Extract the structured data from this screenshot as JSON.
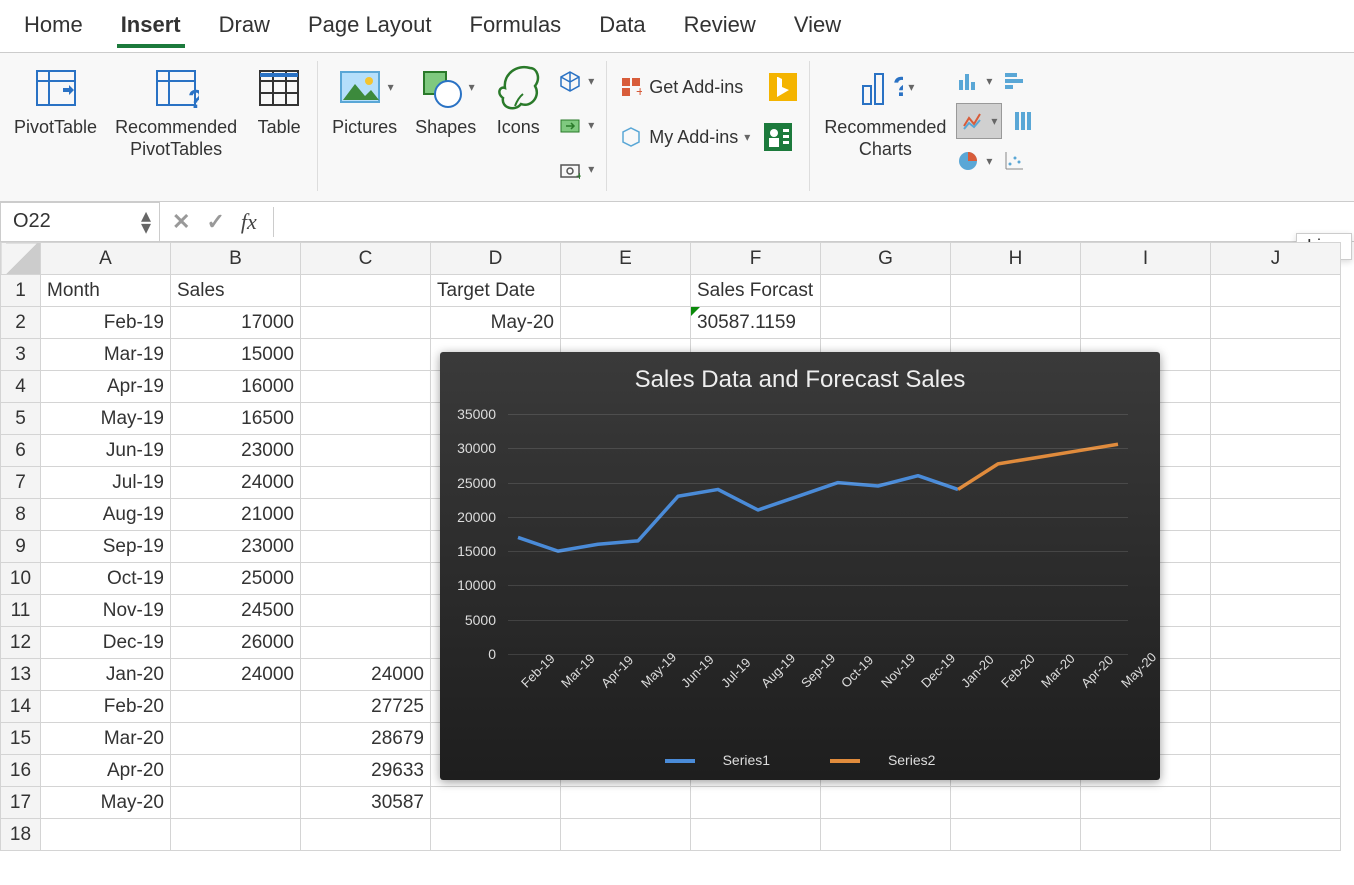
{
  "tabs": [
    "Home",
    "Insert",
    "Draw",
    "Page Layout",
    "Formulas",
    "Data",
    "Review",
    "View"
  ],
  "active_tab": "Insert",
  "ribbon": {
    "pivottable": "PivotTable",
    "recommended_pvt": "Recommended\nPivotTables",
    "table": "Table",
    "pictures": "Pictures",
    "shapes": "Shapes",
    "icons": "Icons",
    "get_addins": "Get Add-ins",
    "my_addins": "My Add-ins",
    "recommended_charts": "Recommended\nCharts"
  },
  "tooltip_line": "Line",
  "cell_ref": "O22",
  "cols": [
    "A",
    "B",
    "C",
    "D",
    "E",
    "F",
    "G",
    "H",
    "I",
    "J"
  ],
  "sheet": {
    "headers": {
      "A1": "Month",
      "B1": "Sales",
      "D1": "Target Date",
      "F1": "Sales Forcast"
    },
    "D2": "May-20",
    "F2": "30587.1159",
    "months": [
      "Feb-19",
      "Mar-19",
      "Apr-19",
      "May-19",
      "Jun-19",
      "Jul-19",
      "Aug-19",
      "Sep-19",
      "Oct-19",
      "Nov-19",
      "Dec-19",
      "Jan-20",
      "Feb-20",
      "Mar-20",
      "Apr-20",
      "May-20"
    ],
    "sales": [
      "17000",
      "15000",
      "16000",
      "16500",
      "23000",
      "24000",
      "21000",
      "23000",
      "25000",
      "24500",
      "26000",
      "24000",
      "",
      "",
      "",
      ""
    ],
    "colC": [
      "",
      "",
      "",
      "",
      "",
      "",
      "",
      "",
      "",
      "",
      "",
      "24000",
      "27725",
      "28679",
      "29633",
      "30587"
    ]
  },
  "chart_data": {
    "type": "line",
    "title": "Sales Data and Forecast Sales",
    "ylim": [
      0,
      35000
    ],
    "yticks": [
      0,
      5000,
      10000,
      15000,
      20000,
      25000,
      30000,
      35000
    ],
    "categories": [
      "Feb-19",
      "Mar-19",
      "Apr-19",
      "May-19",
      "Jun-19",
      "Jul-19",
      "Aug-19",
      "Sep-19",
      "Oct-19",
      "Nov-19",
      "Dec-19",
      "Jan-20",
      "Feb-20",
      "Mar-20",
      "Apr-20",
      "May-20"
    ],
    "series": [
      {
        "name": "Series1",
        "color": "#4a8bd8",
        "values": [
          17000,
          15000,
          16000,
          16500,
          23000,
          24000,
          21000,
          23000,
          25000,
          24500,
          26000,
          24000,
          null,
          null,
          null,
          null
        ]
      },
      {
        "name": "Series2",
        "color": "#e08b3c",
        "values": [
          null,
          null,
          null,
          null,
          null,
          null,
          null,
          null,
          null,
          null,
          null,
          24000,
          27725,
          28679,
          29633,
          30587
        ]
      }
    ]
  }
}
